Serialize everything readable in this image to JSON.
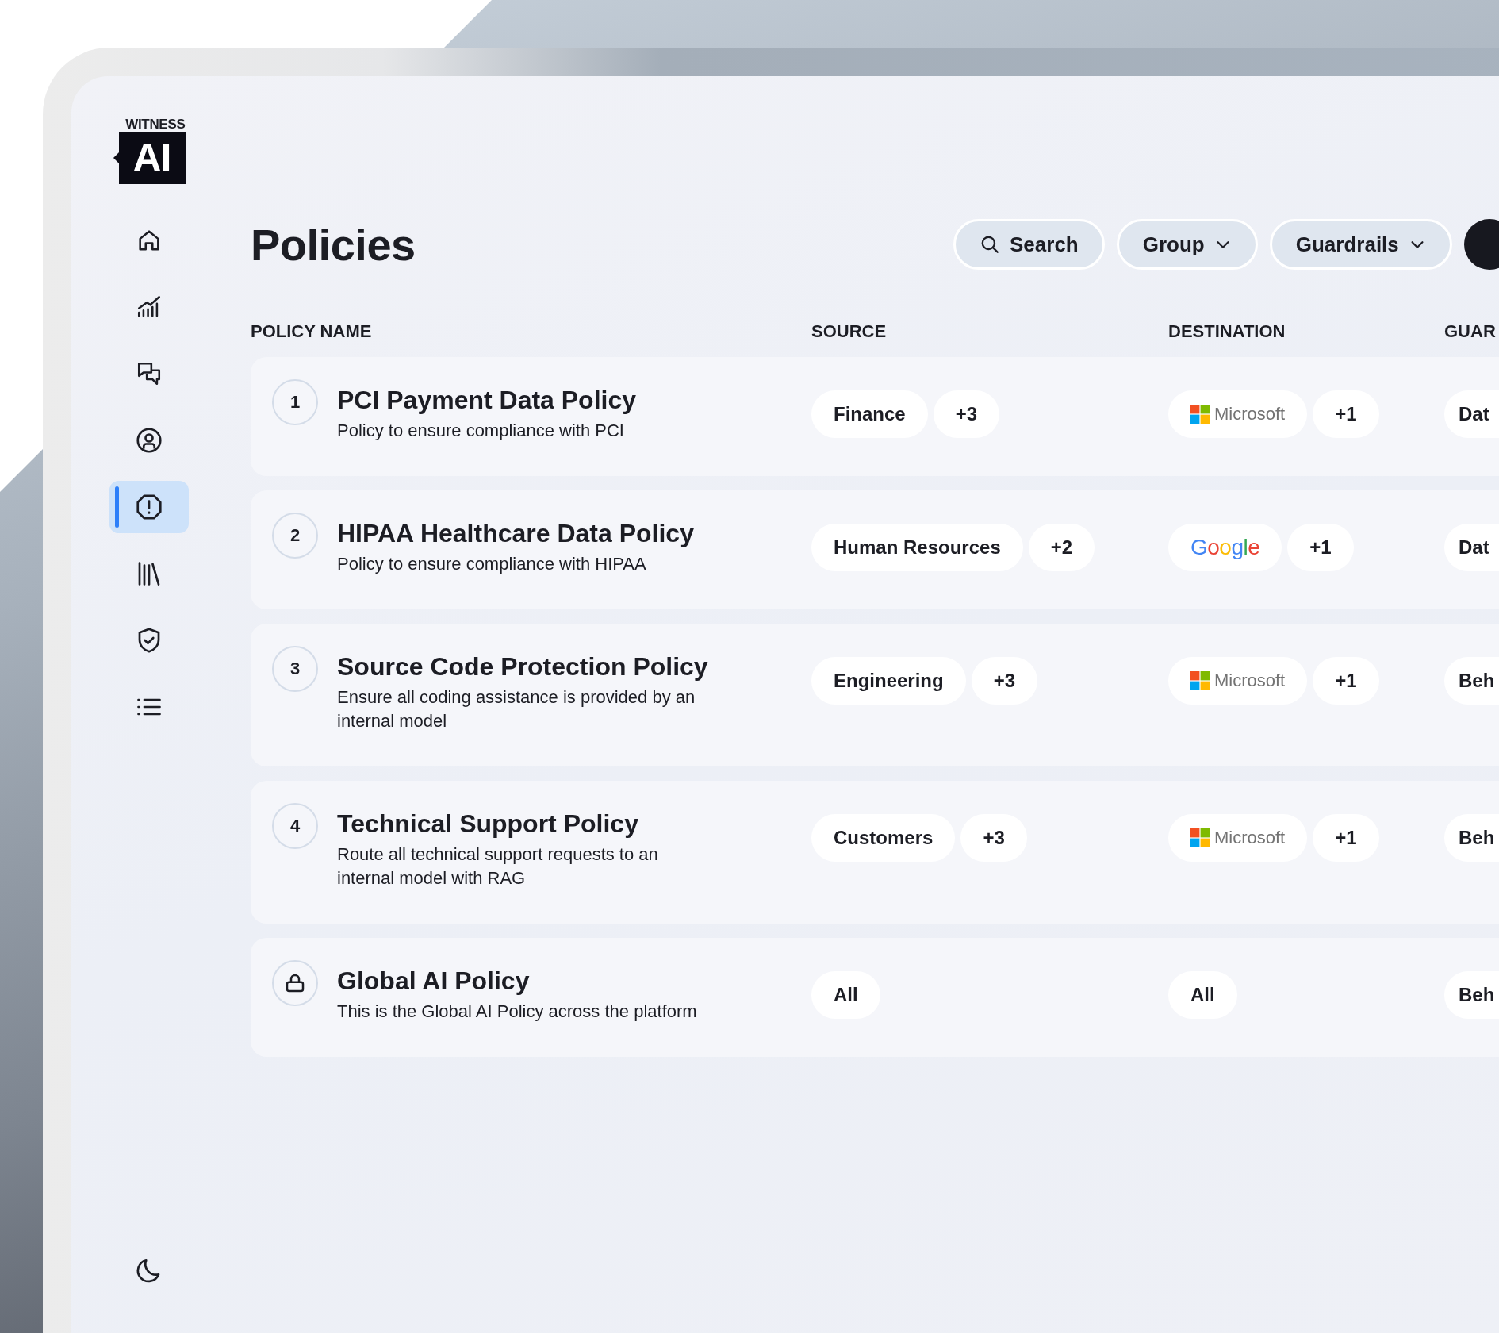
{
  "logo": {
    "top": "WITNESS",
    "mark": "AI"
  },
  "sidebar": {
    "items": [
      {
        "kind": "home",
        "selected": false
      },
      {
        "kind": "chart",
        "selected": false
      },
      {
        "kind": "chat",
        "selected": false
      },
      {
        "kind": "user",
        "selected": false
      },
      {
        "kind": "alert",
        "selected": true
      },
      {
        "kind": "library",
        "selected": false
      },
      {
        "kind": "shield",
        "selected": false
      },
      {
        "kind": "list",
        "selected": false
      }
    ]
  },
  "page": {
    "title": "Policies"
  },
  "toolbar": [
    {
      "kind": "search",
      "label": "Search"
    },
    {
      "kind": "dropdown",
      "label": "Group"
    },
    {
      "kind": "dropdown",
      "label": "Guardrails"
    }
  ],
  "table": {
    "columns": [
      "POLICY NAME",
      "SOURCE",
      "DESTINATION",
      "GUAR"
    ],
    "rows": [
      {
        "kind": "numbered",
        "number": "1",
        "name": "PCI Payment Data Policy",
        "description": "Policy to ensure compliance with PCI",
        "source": [
          "Finance",
          "+3"
        ],
        "destination": [
          {
            "kind": "microsoft",
            "label": "Microsoft"
          },
          {
            "kind": "text",
            "label": "+1"
          }
        ],
        "guardrail": "Dat"
      },
      {
        "kind": "numbered",
        "number": "2",
        "name": "HIPAA Healthcare Data Policy",
        "description": "Policy to ensure compliance with HIPAA",
        "source": [
          "Human Resources",
          "+2"
        ],
        "destination": [
          {
            "kind": "google",
            "label": "Google"
          },
          {
            "kind": "text",
            "label": "+1"
          }
        ],
        "guardrail": "Dat"
      },
      {
        "kind": "numbered",
        "number": "3",
        "name": "Source Code Protection Policy",
        "description": "Ensure all coding assistance is provided by an internal model",
        "source": [
          "Engineering",
          "+3"
        ],
        "destination": [
          {
            "kind": "microsoft",
            "label": "Microsoft"
          },
          {
            "kind": "text",
            "label": "+1"
          }
        ],
        "guardrail": "Beh"
      },
      {
        "kind": "numbered",
        "number": "4",
        "name": "Technical Support Policy",
        "description": "Route all technical support requests to an internal model with RAG",
        "source": [
          "Customers",
          "+3"
        ],
        "destination": [
          {
            "kind": "microsoft",
            "label": "Microsoft"
          },
          {
            "kind": "text",
            "label": "+1"
          }
        ],
        "guardrail": "Beh"
      },
      {
        "kind": "locked",
        "name": "Global AI Policy",
        "description": "This is the Global AI Policy across the platform",
        "source": [
          "All"
        ],
        "destination": [
          {
            "kind": "text",
            "label": "All"
          }
        ],
        "guardrail": "Beh"
      }
    ]
  }
}
